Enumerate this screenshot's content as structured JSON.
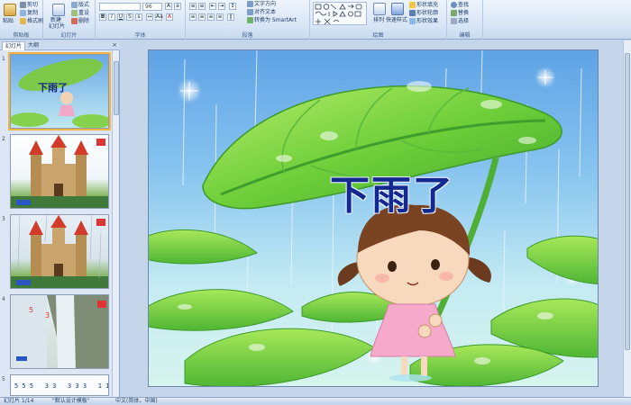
{
  "ribbon": {
    "clipboard": {
      "paste": "粘贴",
      "cut": "剪切",
      "copy": "复制",
      "format_painter": "格式刷",
      "label": "剪贴板"
    },
    "slides": {
      "new_slide": "新建",
      "new_slide_line2": "幻灯片",
      "layout": "版式",
      "reset": "重设",
      "delete": "删除",
      "label": "幻灯片"
    },
    "font": {
      "font_size": "96",
      "label": "字体"
    },
    "paragraph": {
      "text_direction": "文字方向",
      "align_text": "对齐文本",
      "smartart": "转换为 SmartArt",
      "label": "段落"
    },
    "drawing": {
      "arrange": "排列",
      "quick_styles": "快速样式",
      "shape_fill": "形状填充",
      "shape_outline": "形状轮廓",
      "shape_effects": "形状效果",
      "label": "绘图"
    },
    "editing": {
      "find": "查找",
      "replace": "替换",
      "select": "选择",
      "label": "编辑"
    }
  },
  "panel": {
    "tab_slides": "幻灯片",
    "tab_outline": "大纲",
    "close": "×",
    "slide_numbers": [
      "1",
      "2",
      "3",
      "4",
      "5"
    ],
    "thumb1_title": "下雨了",
    "thumb4_numbers": [
      "5",
      "3"
    ],
    "thumb5_notation": "5 5 5   3 3   3 3 3   1 1"
  },
  "slide": {
    "title": "下雨了"
  },
  "status": {
    "slide_counter": "幻灯片 1/14",
    "theme": "\"默认设计模板\"",
    "language": "中文(简体，中国)"
  },
  "colors": {
    "accent": "#f0b542",
    "title": "#14298f",
    "ribbon_text": "#1b3b6b"
  }
}
